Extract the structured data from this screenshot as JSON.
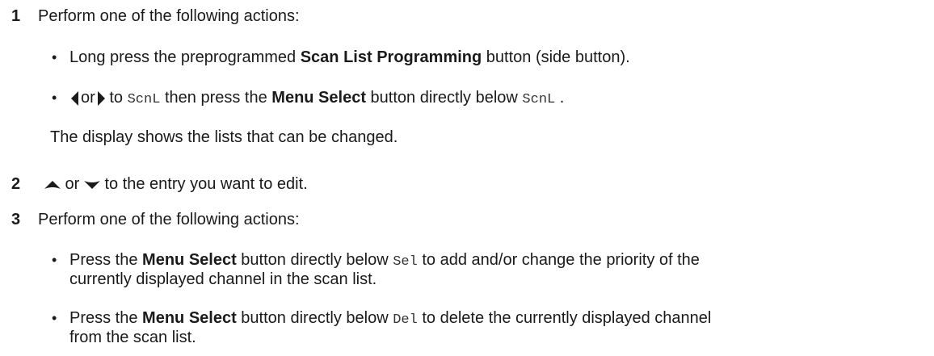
{
  "steps": [
    {
      "number": "1",
      "text": "Perform one of the following actions:",
      "bullets": [
        {
          "pre": "Long press the preprogrammed ",
          "bold": "Scan List Programming",
          "post": " button (side button)."
        },
        {
          "left_arrow_icon": "left-triangle-arrow",
          "or": "or",
          "right_arrow_icon": "right-triangle-arrow",
          "to": " to ",
          "code1": "ScnL",
          "mid": " then press the ",
          "bold": "Menu Select",
          "post": " button directly below ",
          "code2": "ScnL",
          "end": " ."
        }
      ],
      "note": "The display shows the lists that can be changed."
    },
    {
      "number": "2",
      "up_icon": "up-arrow",
      "or": " or ",
      "down_icon": "down-arrow",
      "text": " to the entry you want to edit."
    },
    {
      "number": "3",
      "text": "Perform one of the following actions:",
      "bullets": [
        {
          "pre": "Press the ",
          "bold": "Menu Select",
          "mid": " button directly below ",
          "code": "Sel",
          "post": " to add and/or change the priority of the",
          "cont": "currently displayed channel in the scan list."
        },
        {
          "pre": "Press the ",
          "bold": "Menu Select",
          "mid": " button directly below ",
          "code": "Del",
          "post": " to delete the currently displayed channel",
          "cont": "from the scan list."
        }
      ]
    }
  ]
}
